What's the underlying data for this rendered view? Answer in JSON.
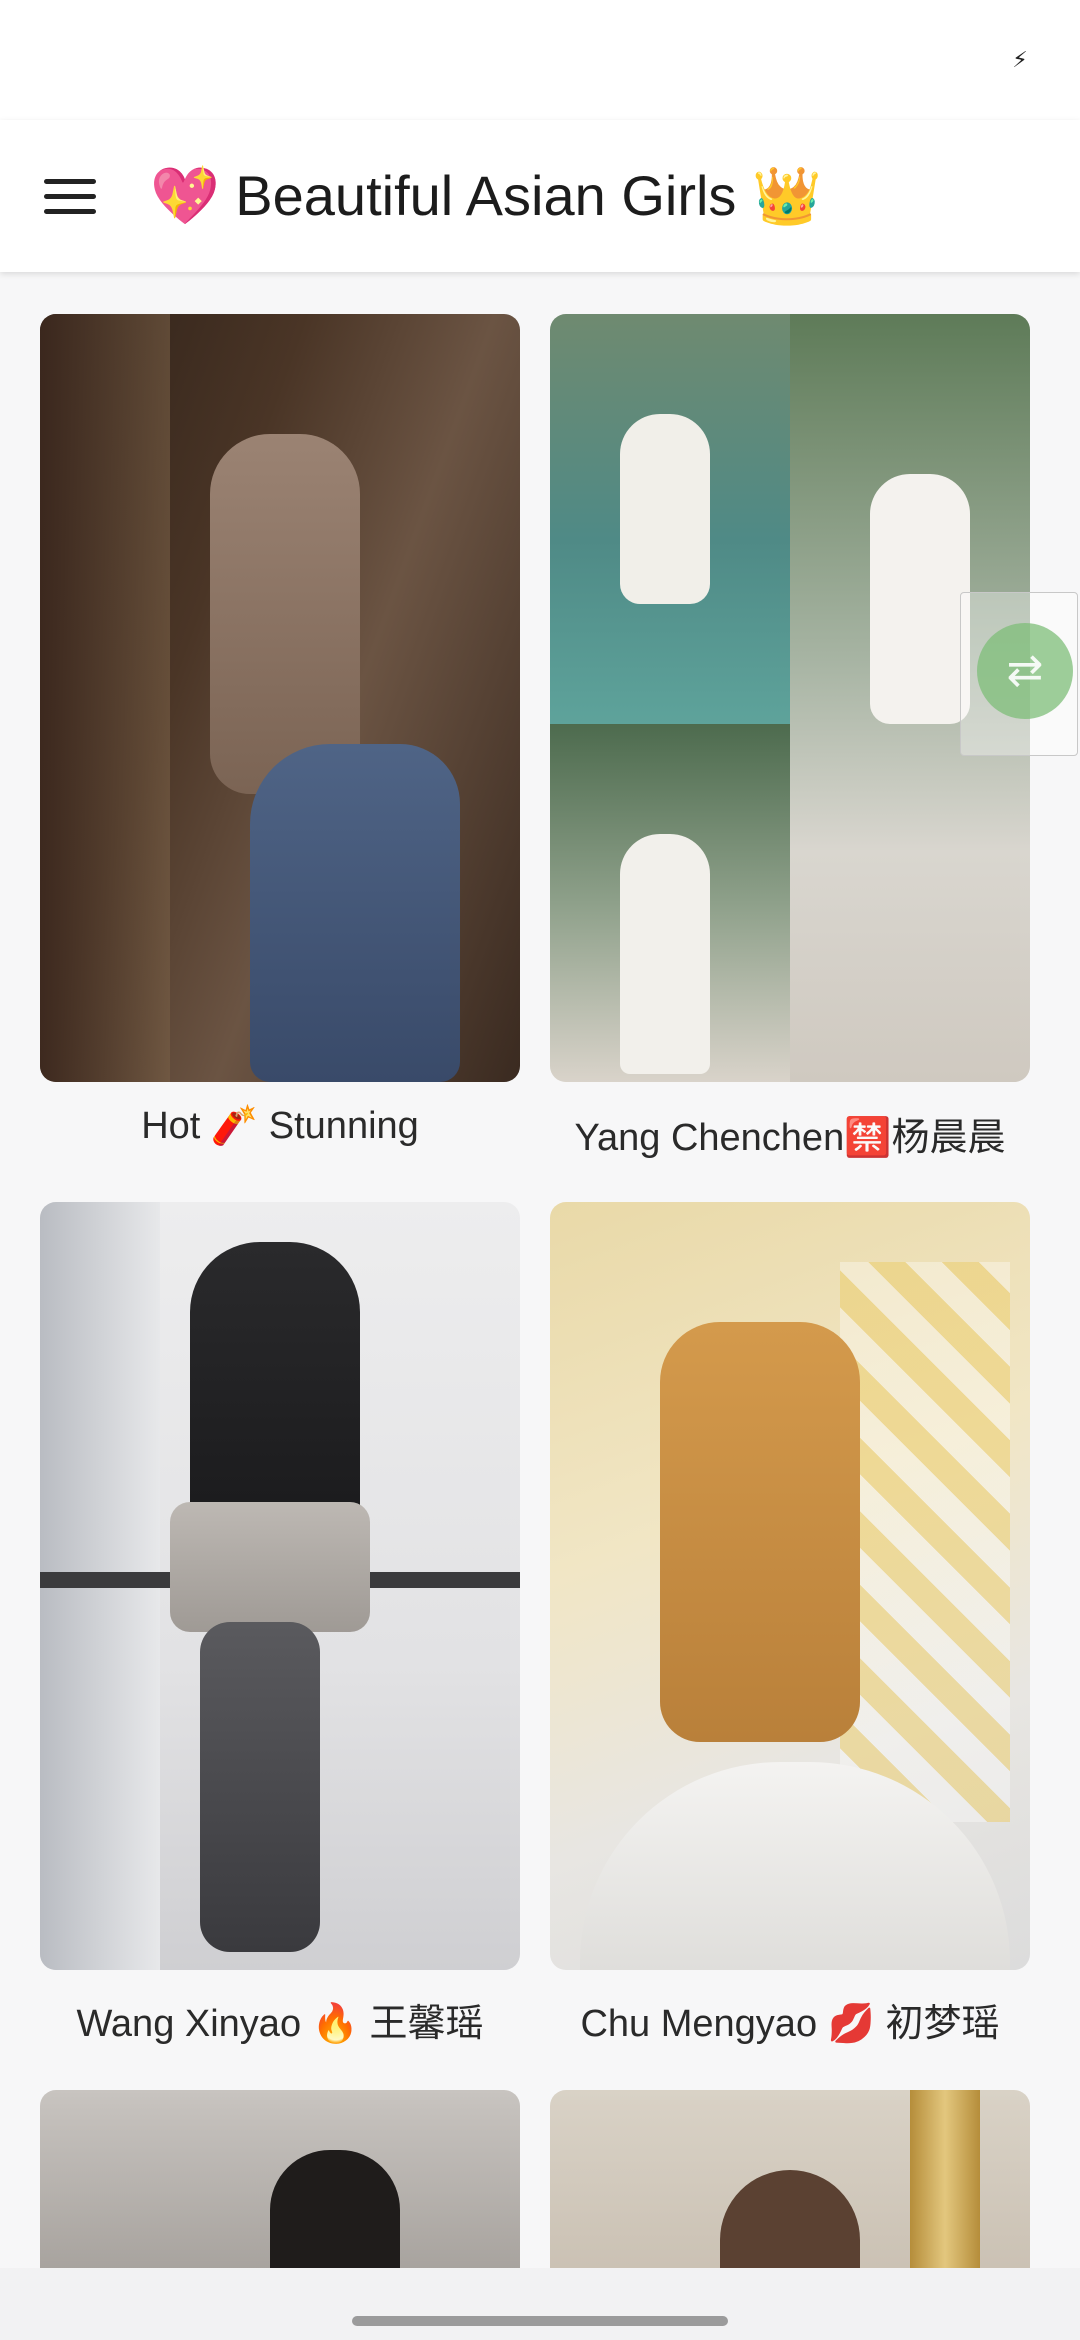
{
  "status_bar": {
    "icon": "lightning-icon",
    "icon_glyph": "⚡"
  },
  "app_bar": {
    "menu_icon": "hamburger-menu-icon",
    "title": "💖 Beautiful Asian Girls 👑"
  },
  "gallery": {
    "items": [
      {
        "caption": "Hot 🧨 Stunning"
      },
      {
        "caption": "Yang Chenchen🈲杨晨晨"
      },
      {
        "caption": "Wang Xinyao 🔥 王馨瑶"
      },
      {
        "caption": "Chu Mengyao 💋 初梦瑶"
      },
      {
        "caption": ""
      },
      {
        "caption": ""
      }
    ]
  },
  "floating_widget": {
    "icon": "translate-icon",
    "glyph": "⇄"
  },
  "colors": {
    "app_bar_bg": "#ffffff",
    "page_bg": "#f7f7f8",
    "widget_green": "#7ebe78"
  }
}
